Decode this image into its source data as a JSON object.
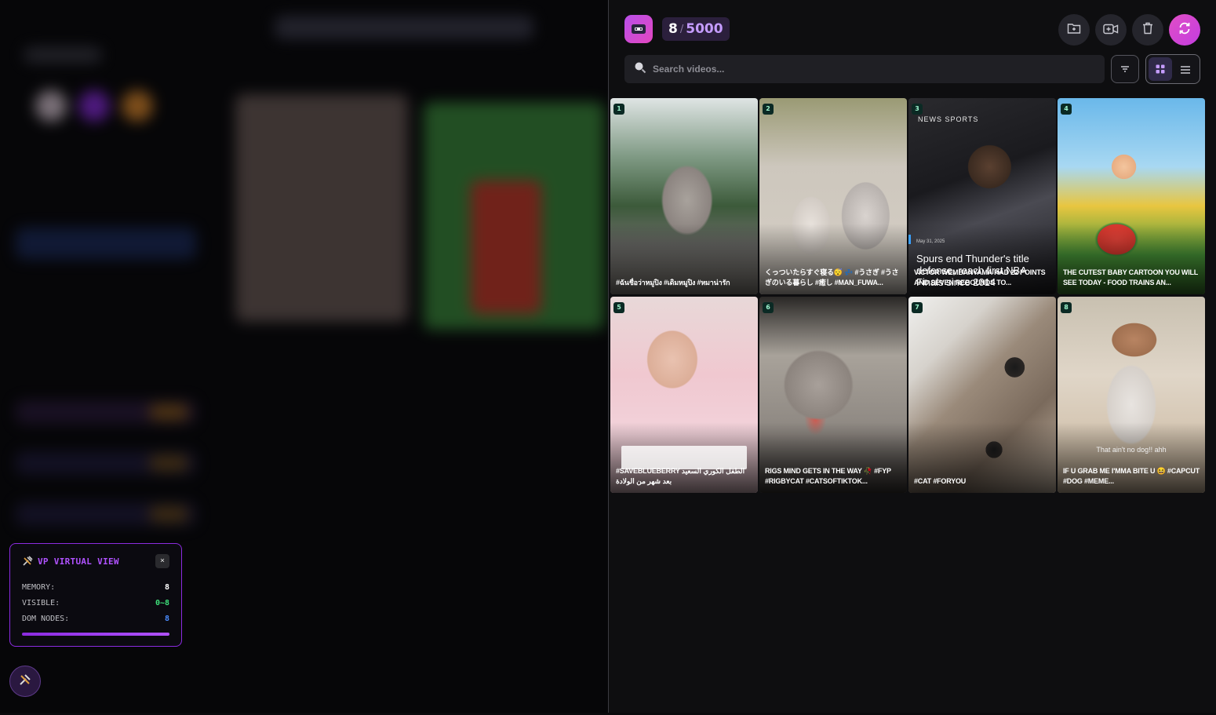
{
  "header": {
    "count_current": "8",
    "count_separator": "/",
    "count_max": "5000"
  },
  "search": {
    "placeholder": "Search videos..."
  },
  "videos": [
    {
      "index": "1",
      "caption": "#ฉันชื่อว่าหมูปิง #เดิมหมูปิง #หมาน่ารัก"
    },
    {
      "index": "2",
      "caption": "くっついたらすぐ寝る😴 💤 #うさぎ #うさぎのいる暮らし #癒し #MAN_FUWA..."
    },
    {
      "index": "3",
      "caption": "VICTOR WEMBANYAMA HAD 22 POINTS AND SEVEN REBOUNDS TO...",
      "overlay_title": "Spurs end Thunder's title defense, reach first NBA Finals since 2014",
      "overlay_date": "May 31, 2025",
      "overlay_brand": "NEWS SPORTS"
    },
    {
      "index": "4",
      "caption": "THE CUTEST BABY CARTOON YOU WILL SEE TODAY - FOOD TRAINS AN..."
    },
    {
      "index": "5",
      "caption": "#SAVEBLUEBERRY الطفل الكوري السعيد بعد شهر من الولادة"
    },
    {
      "index": "6",
      "caption": "RIGS MIND GETS IN THE WAY 🥀 #FYP #RIGBYCAT #CATSOFTIKTOK..."
    },
    {
      "index": "7",
      "caption": "#CAT #FORYOU"
    },
    {
      "index": "8",
      "caption": "IF U GRAB ME I'MMA BITE U 😆 #CAPCUT #DOG #MEME...",
      "overlay_sub": "That ain't no dog!! ahh"
    }
  ],
  "debug_panel": {
    "title": "VP VIRTUAL VIEW",
    "close": "×",
    "rows": [
      {
        "label": "MEMORY:",
        "value": "8"
      },
      {
        "label": "VISIBLE:",
        "value": "0~8"
      },
      {
        "label": "DOM NODES:",
        "value": "8"
      }
    ],
    "progress_fraction": 1.0
  },
  "colors": {
    "accent": "#b052ff",
    "accent_pink": "#e04ec5",
    "memory_value": "#ffffff",
    "visible_value": "#3ee07a",
    "dom_value": "#4a8cff",
    "index_text": "#9ef5cf"
  },
  "icons": {
    "logo": "video-tape-icon",
    "import": "folder-plus-icon",
    "add_video": "video-plus-icon",
    "delete": "trash-icon",
    "refresh": "refresh-icon",
    "search": "search-icon",
    "filter": "filter-icon",
    "grid_view": "grid-icon",
    "list_view": "list-icon",
    "debug": "tools-icon"
  }
}
